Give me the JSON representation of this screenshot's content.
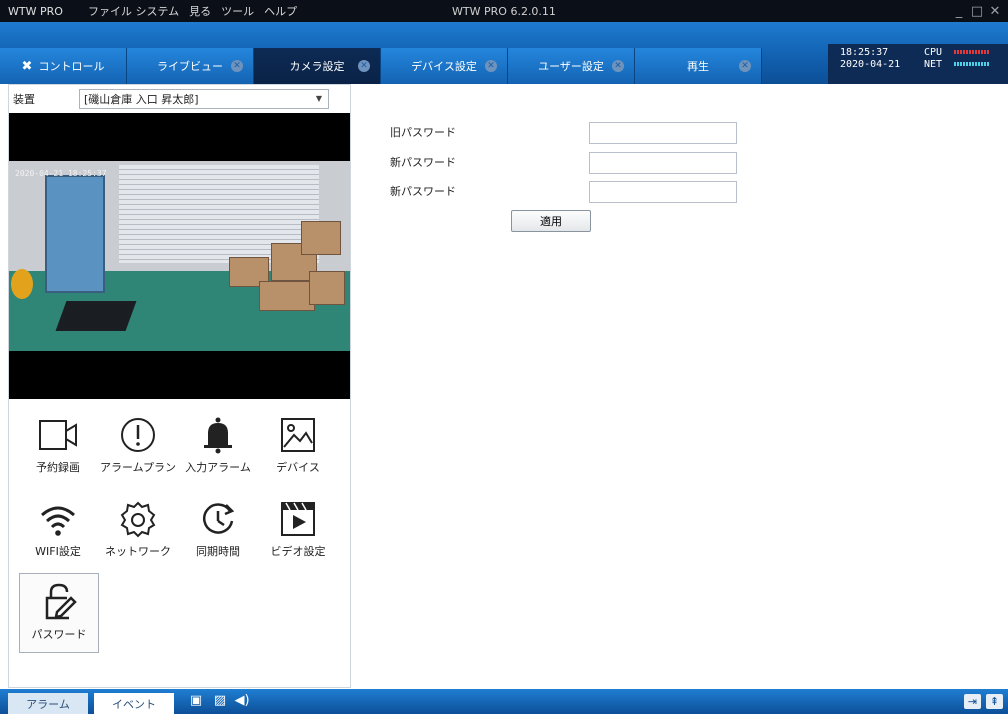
{
  "window": {
    "app_name": "WTW PRO",
    "title": "WTW PRO 6.2.0.11",
    "menu": [
      "ファイル システム",
      "見る",
      "ツール",
      "ヘルプ"
    ]
  },
  "tabs": [
    {
      "label": "コントロール",
      "active": false
    },
    {
      "label": "ライブビュー",
      "active": false
    },
    {
      "label": "カメラ設定",
      "active": true
    },
    {
      "label": "デバイス設定",
      "active": false
    },
    {
      "label": "ユーザー設定",
      "active": false
    },
    {
      "label": "再生",
      "active": false
    }
  ],
  "status": {
    "time": "18:25:37",
    "date": "2020-04-21",
    "cpu_label": "CPU",
    "net_label": "NET"
  },
  "device": {
    "label": "装置",
    "selected": "[磯山倉庫 入口 昇太郎]"
  },
  "video": {
    "timestamp": "2020-04-21 18:25:37"
  },
  "settings_icons": [
    {
      "label": "予約録画",
      "icon": "video-camera-icon"
    },
    {
      "label": "アラームプラン",
      "icon": "alert-circle-icon"
    },
    {
      "label": "入力アラーム",
      "icon": "bell-icon"
    },
    {
      "label": "デバイス",
      "icon": "image-icon"
    },
    {
      "label": "WIFI設定",
      "icon": "wifi-icon"
    },
    {
      "label": "ネットワーク",
      "icon": "network-gear-icon"
    },
    {
      "label": "同期時間",
      "icon": "sync-clock-icon"
    },
    {
      "label": "ビデオ設定",
      "icon": "clapperboard-icon"
    },
    {
      "label": "パスワード",
      "icon": "lock-edit-icon"
    }
  ],
  "password_form": {
    "old_label": "旧パスワード",
    "new_label": "新パスワード",
    "confirm_label": "新パスワード",
    "old_value": "",
    "new_value": "",
    "confirm_value": "",
    "apply_label": "適用"
  },
  "bottom": {
    "alarm_tab": "アラーム",
    "event_tab": "イベント"
  },
  "colors": {
    "accent": "#1463b3",
    "active_tab": "#0d2b55",
    "titlebar": "#0b0f18"
  }
}
